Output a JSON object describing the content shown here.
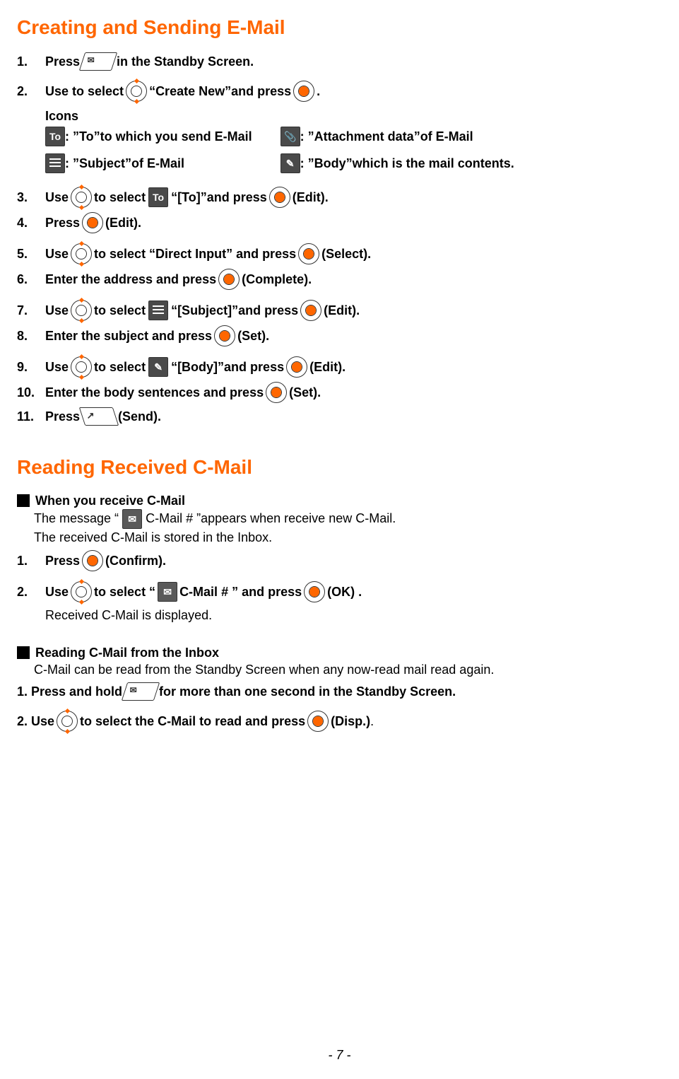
{
  "title1": "Creating and Sending E-Mail",
  "steps_email": {
    "s1": {
      "n": "1.",
      "a": "Press ",
      "b": " in the Standby Screen."
    },
    "s2": {
      "n": "2.",
      "a": "Use to select ",
      "b": " “Create New”and press ",
      "c": " ."
    },
    "icons_label": "Icons",
    "icon_to": " : ”To”to which you send E-Mail",
    "icon_subject": " : ”Subject”of E-Mail",
    "icon_attach": " : ”Attachment data”of E-Mail",
    "icon_body": " : ”Body”which is the mail contents.",
    "s3": {
      "n": "3.",
      "a": "Use ",
      "b": " to select ",
      "c": " “[To]”and press ",
      "d": " (Edit)."
    },
    "s4": {
      "n": "4.",
      "a": "Press ",
      "b": " (Edit)."
    },
    "s5": {
      "n": "5.",
      "a": "Use ",
      "b": " to select “Direct Input” and press ",
      "c": " (Select)."
    },
    "s6": {
      "n": "6.",
      "a": "Enter the address and press ",
      "b": " (Complete)."
    },
    "s7": {
      "n": "7.",
      "a": "Use ",
      "b": " to select ",
      "c": " “[Subject]”and press ",
      "d": " (Edit)."
    },
    "s8": {
      "n": "8.",
      "a": "Enter the subject and press ",
      "b": " (Set)."
    },
    "s9": {
      "n": "9.",
      "a": "Use ",
      "b": " to select ",
      "c": " “[Body]”and press ",
      "d": " (Edit)."
    },
    "s10": {
      "n": "10.",
      "a": "Enter the body sentences and press ",
      "b": " (Set)."
    },
    "s11": {
      "n": "11.",
      "a": "Press ",
      "b": " (Send)."
    }
  },
  "title2": "Reading Received C-Mail",
  "cmail": {
    "sub1": "When you receive C-Mail",
    "msg_a": "The message “ ",
    "msg_b": " C-Mail # ”appears when receive new C-Mail.",
    "msg2": "The received C-Mail is stored in the Inbox.",
    "s1": {
      "n": "1.",
      "a": "Press ",
      "b": " (Confirm)."
    },
    "s2": {
      "n": "2.",
      "a": "Use ",
      "b": " to select “ ",
      "c": " C-Mail # ” and press ",
      "d": " (OK) ."
    },
    "rcvd": "Received C-Mail is displayed.",
    "sub2": "Reading C-Mail from the Inbox",
    "sub2_desc": "C-Mail can be read from the Standby Screen when any now-read mail read again.",
    "b1": {
      "a": "1. Press and hold ",
      "b": " for more than one second in the Standby Screen."
    },
    "b2": {
      "a": "2. Use ",
      "b": " to select the C-Mail to read and press ",
      "c": " (Disp.) ",
      "d": "."
    }
  },
  "page_num": "- 7 -"
}
